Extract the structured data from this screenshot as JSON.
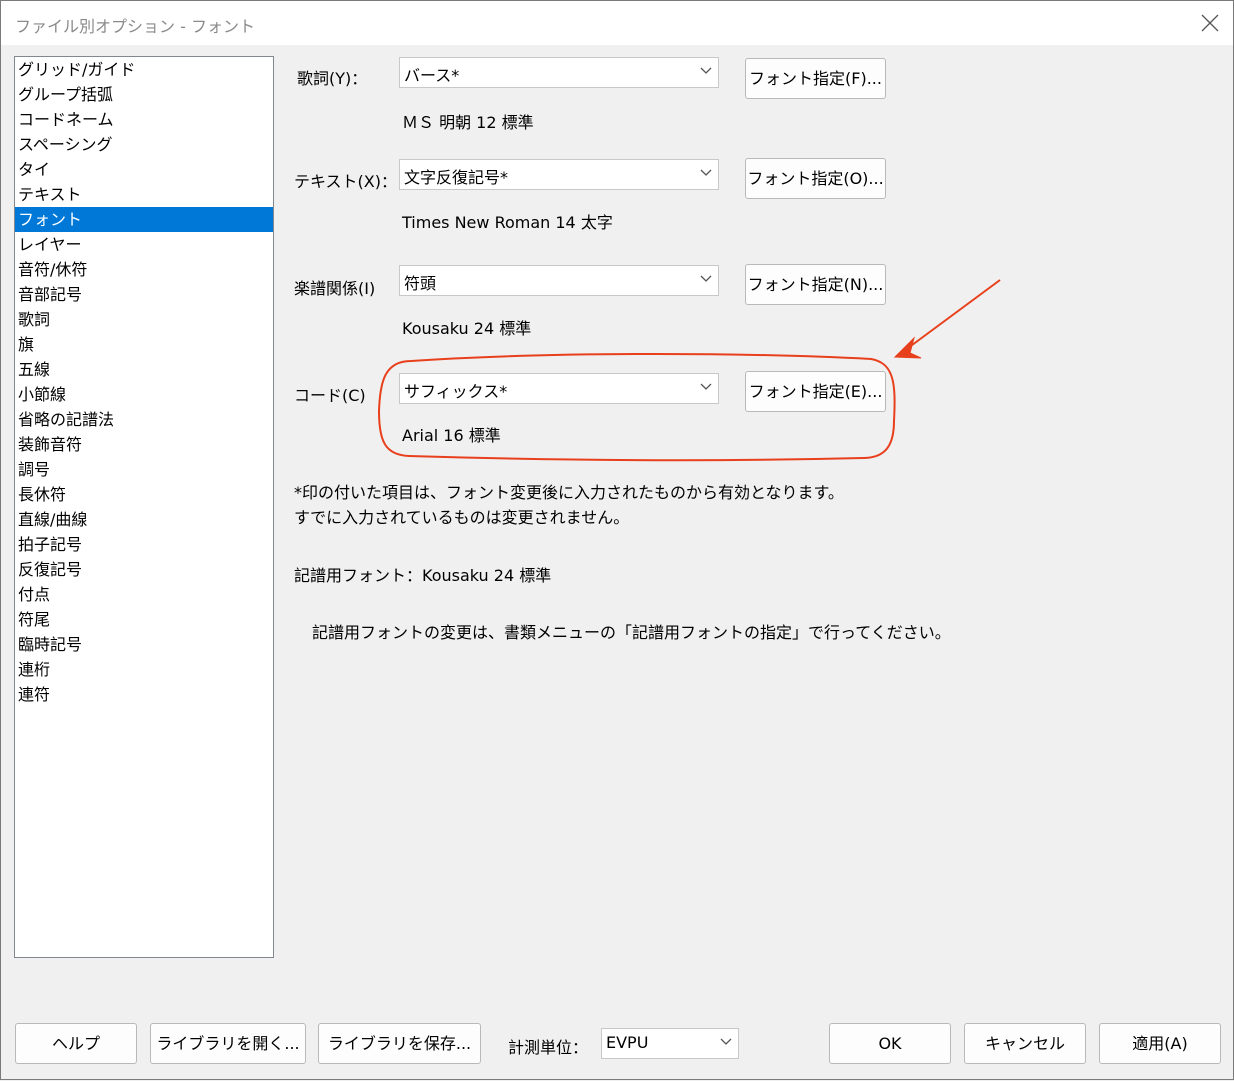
{
  "window": {
    "title": "ファイル別オプション - フォント"
  },
  "categories": [
    "グリッド/ガイド",
    "グループ括弧",
    "コードネーム",
    "スペーシング",
    "タイ",
    "テキスト",
    "フォント",
    "レイヤー",
    "音符/休符",
    "音部記号",
    "歌詞",
    "旗",
    "五線",
    "小節線",
    "省略の記譜法",
    "装飾音符",
    "調号",
    "長休符",
    "直線/曲線",
    "拍子記号",
    "反復記号",
    "付点",
    "符尾",
    "臨時記号",
    "連桁",
    "連符"
  ],
  "selected_category": "フォント",
  "font_rows": {
    "lyrics": {
      "label": "歌詞(Y)：",
      "value": "バース*",
      "button": "フォント指定(F)...",
      "info": "ＭＳ 明朝 12 標準"
    },
    "text": {
      "label": "テキスト(X)：",
      "value": "文字反復記号*",
      "button": "フォント指定(O)...",
      "info": "Times New Roman 14 太字"
    },
    "notation": {
      "label": "楽譜関係(I)",
      "value": "符頭",
      "button": "フォント指定(N)...",
      "info": "Kousaku 24 標準"
    },
    "chord": {
      "label": "コード(C)",
      "value": "サフィックス*",
      "button": "フォント指定(E)...",
      "info": "Arial 16 標準"
    }
  },
  "note_line1": "*印の付いた項目は、フォント変更後に入力されたものから有効となります。",
  "note_line2": "すでに入力されているものは変更されません。",
  "music_font_label": "記譜用フォント：",
  "music_font_value": "Kousaku 24 標準",
  "music_font_note": "記譜用フォントの変更は、書類メニューの「記譜用フォントの指定」で行ってください。",
  "footer": {
    "help": "ヘルプ",
    "open_library": "ライブラリを開く...",
    "save_library": "ライブラリを保存...",
    "unit_label": "計測単位：",
    "unit_value": "EVPU",
    "ok": "OK",
    "cancel": "キャンセル",
    "apply": "適用(A)"
  },
  "colors": {
    "selection": "#0078d7",
    "annotation": "#e8401c"
  },
  "icons": [
    "close-icon",
    "chevron-down-icon"
  ]
}
